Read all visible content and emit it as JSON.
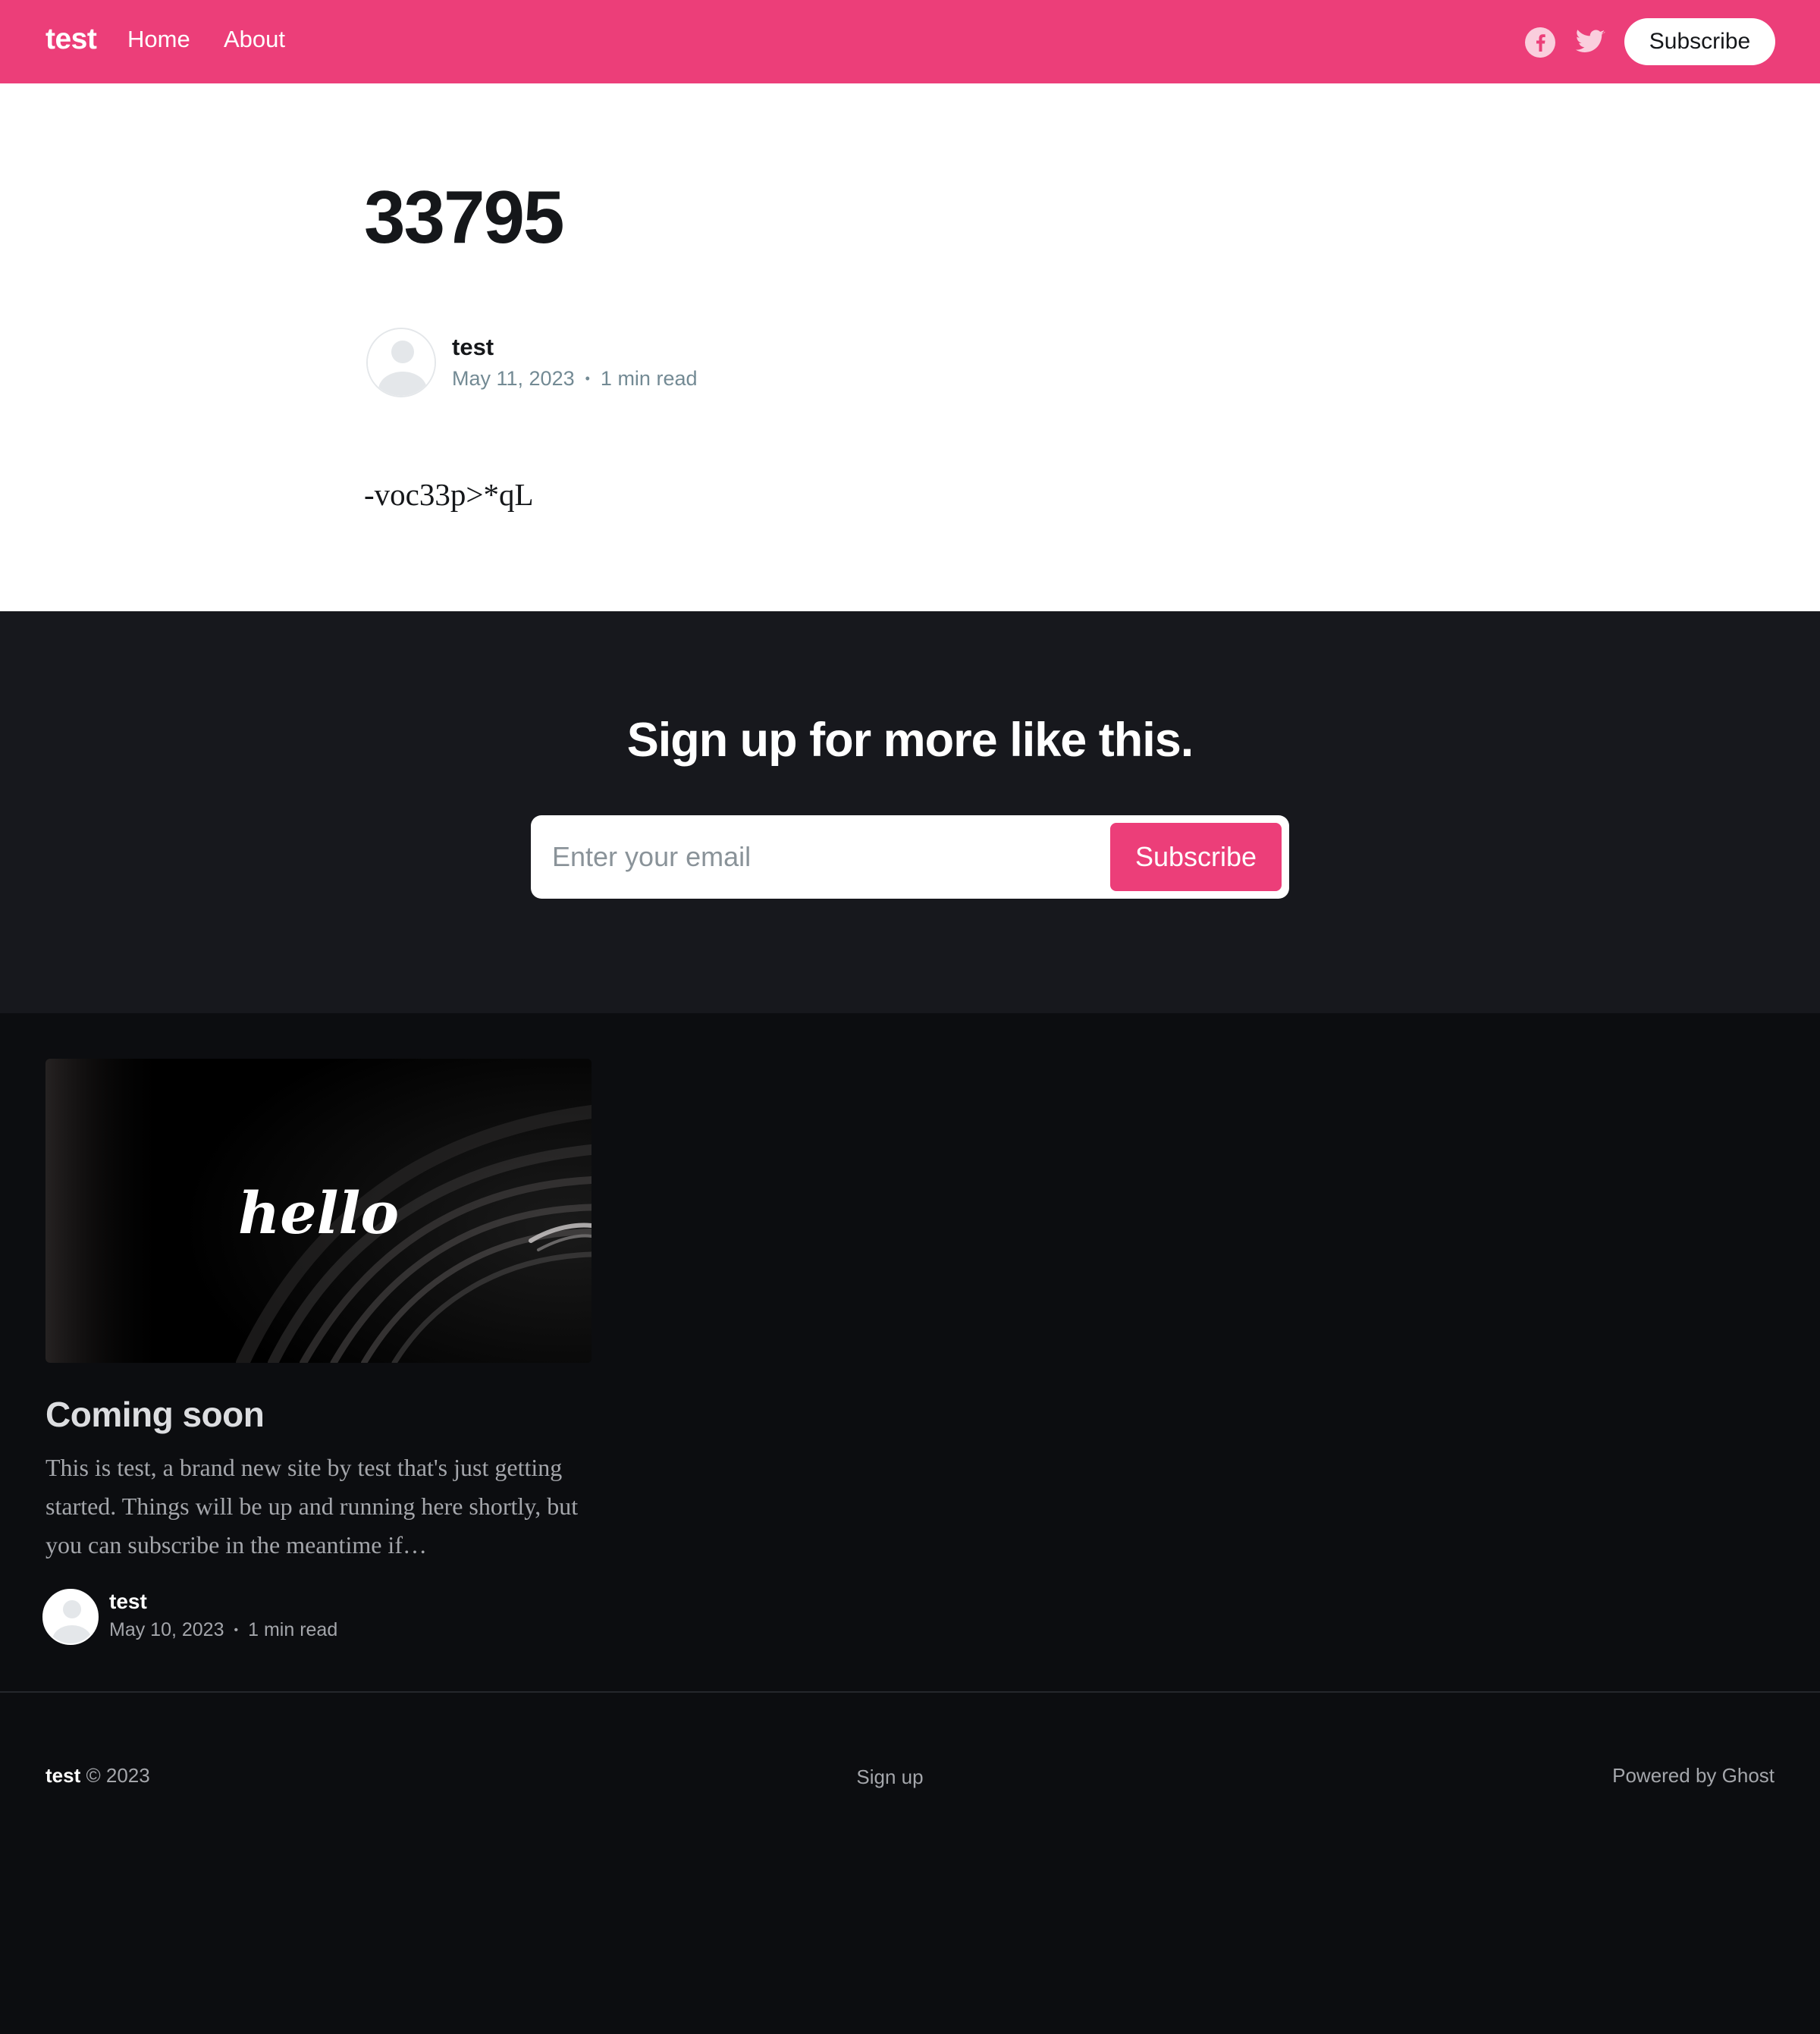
{
  "header": {
    "logo": "test",
    "nav": [
      {
        "label": "Home"
      },
      {
        "label": "About"
      }
    ],
    "social_icons": [
      "facebook-icon",
      "twitter-icon"
    ],
    "subscribe_label": "Subscribe",
    "brand_color": "#ec3e79"
  },
  "article": {
    "title": "33795",
    "author": "test",
    "date": "May 11, 2023",
    "reading_time": "1 min read",
    "body": "-voc33p>*qL"
  },
  "signup": {
    "title": "Sign up for more like this.",
    "email_placeholder": "Enter your email",
    "button_label": "Subscribe"
  },
  "feed": {
    "cards": [
      {
        "image_text": "hello",
        "title": "Coming soon",
        "excerpt": "This is test, a brand new site by test that's just getting started. Things will be up and running here shortly, but you can subscribe in the meantime if…",
        "author": "test",
        "date": "May 10, 2023",
        "reading_time": "1 min read"
      }
    ]
  },
  "footer": {
    "site_name": "test",
    "copyright": "© 2023",
    "signup_link": "Sign up",
    "powered_by": "Powered by Ghost"
  }
}
